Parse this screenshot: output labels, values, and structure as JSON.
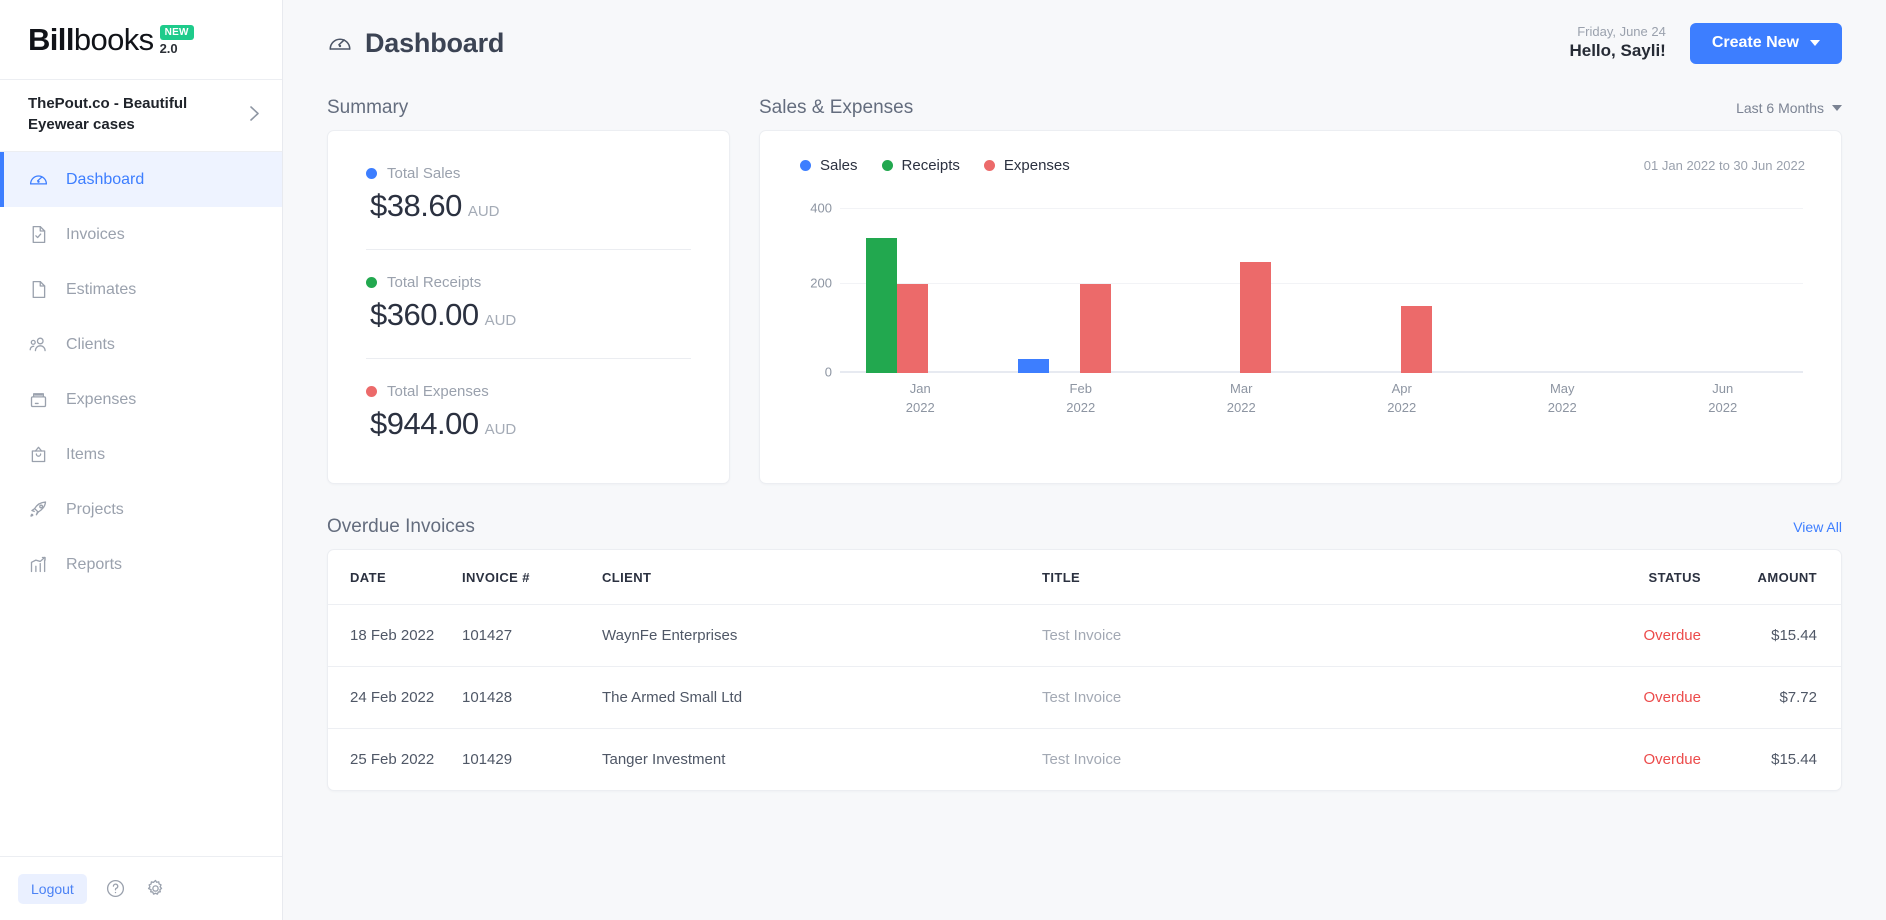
{
  "brand": {
    "name_bold": "Bill",
    "name_light": "books",
    "badge": "NEW",
    "version": "2.0"
  },
  "sidebar": {
    "organization": "ThePout.co - Beautiful Eyewear cases",
    "org_chevron_icon": "chevron-right-icon",
    "items": [
      {
        "label": "Dashboard",
        "icon": "speedometer-icon",
        "active": true
      },
      {
        "label": "Invoices",
        "icon": "document-check-icon",
        "active": false
      },
      {
        "label": "Estimates",
        "icon": "document-icon",
        "active": false
      },
      {
        "label": "Clients",
        "icon": "users-icon",
        "active": false
      },
      {
        "label": "Expenses",
        "icon": "cash-box-icon",
        "active": false
      },
      {
        "label": "Items",
        "icon": "bag-icon",
        "active": false
      },
      {
        "label": "Projects",
        "icon": "rocket-icon",
        "active": false
      },
      {
        "label": "Reports",
        "icon": "bar-chart-icon",
        "active": false
      }
    ],
    "footer": {
      "logout_label": "Logout",
      "help_icon": "question-circle-icon",
      "settings_icon": "gear-icon"
    }
  },
  "header": {
    "title": "Dashboard",
    "title_icon": "speedometer-icon",
    "date": "Friday, June 24",
    "greeting": "Hello, Sayli!",
    "create_button": "Create New",
    "create_caret_icon": "caret-down-icon"
  },
  "summary": {
    "section_title": "Summary",
    "items": [
      {
        "label": "Total Sales",
        "amount": "$38.60",
        "currency": "AUD",
        "color": "#3d7eff"
      },
      {
        "label": "Total Receipts",
        "amount": "$360.00",
        "currency": "AUD",
        "color": "#22a84f"
      },
      {
        "label": "Total Expenses",
        "amount": "$944.00",
        "currency": "AUD",
        "color": "#ec6a6a"
      }
    ]
  },
  "sales_expenses": {
    "section_title": "Sales & Expenses",
    "range_label": "Last 6 Months",
    "range_caret_icon": "caret-down-icon",
    "date_range": "01 Jan 2022 to 30 Jun 2022"
  },
  "chart_data": {
    "type": "bar",
    "title": "Sales & Expenses",
    "categories": [
      "Jan 2022",
      "Feb 2022",
      "Mar 2022",
      "Apr 2022",
      "May 2022",
      "Jun 2022"
    ],
    "category_lines": [
      [
        "Jan",
        "2022"
      ],
      [
        "Feb",
        "2022"
      ],
      [
        "Mar",
        "2022"
      ],
      [
        "Apr",
        "2022"
      ],
      [
        "May",
        "2022"
      ],
      [
        "Jun",
        "2022"
      ]
    ],
    "series": [
      {
        "name": "Sales",
        "color": "#3d7eff",
        "values": [
          0,
          38.6,
          0,
          0,
          0,
          0
        ]
      },
      {
        "name": "Receipts",
        "color": "#22a84f",
        "values": [
          360,
          0,
          0,
          0,
          0,
          0
        ]
      },
      {
        "name": "Expenses",
        "color": "#ec6a6a",
        "values": [
          237,
          237,
          295,
          178,
          0,
          0
        ]
      }
    ],
    "xlabel": "",
    "ylabel": "",
    "ylim": [
      0,
      440
    ],
    "yticks": [
      0,
      200,
      400
    ],
    "ytick_labels": [
      "0",
      "200",
      "400"
    ],
    "grid": true,
    "legend_position": "top-left"
  },
  "overdue": {
    "section_title": "Overdue Invoices",
    "view_all": "View All",
    "columns": [
      "DATE",
      "INVOICE #",
      "CLIENT",
      "TITLE",
      "STATUS",
      "AMOUNT"
    ],
    "rows": [
      {
        "date": "18 Feb 2022",
        "invoice": "101427",
        "client": "WaynFe Enterprises",
        "title": "Test Invoice",
        "status": "Overdue",
        "amount": "$15.44"
      },
      {
        "date": "24 Feb 2022",
        "invoice": "101428",
        "client": "The Armed Small Ltd",
        "title": "Test Invoice",
        "status": "Overdue",
        "amount": "$7.72"
      },
      {
        "date": "25 Feb 2022",
        "invoice": "101429",
        "client": "Tanger Investment",
        "title": "Test Invoice",
        "status": "Overdue",
        "amount": "$15.44"
      }
    ]
  },
  "colors": {
    "accent": "#3d7eff",
    "sales": "#3d7eff",
    "receipts": "#22a84f",
    "expenses": "#ec6a6a",
    "overdue": "#ec4b4b",
    "badge_green": "#1ecb8b"
  }
}
